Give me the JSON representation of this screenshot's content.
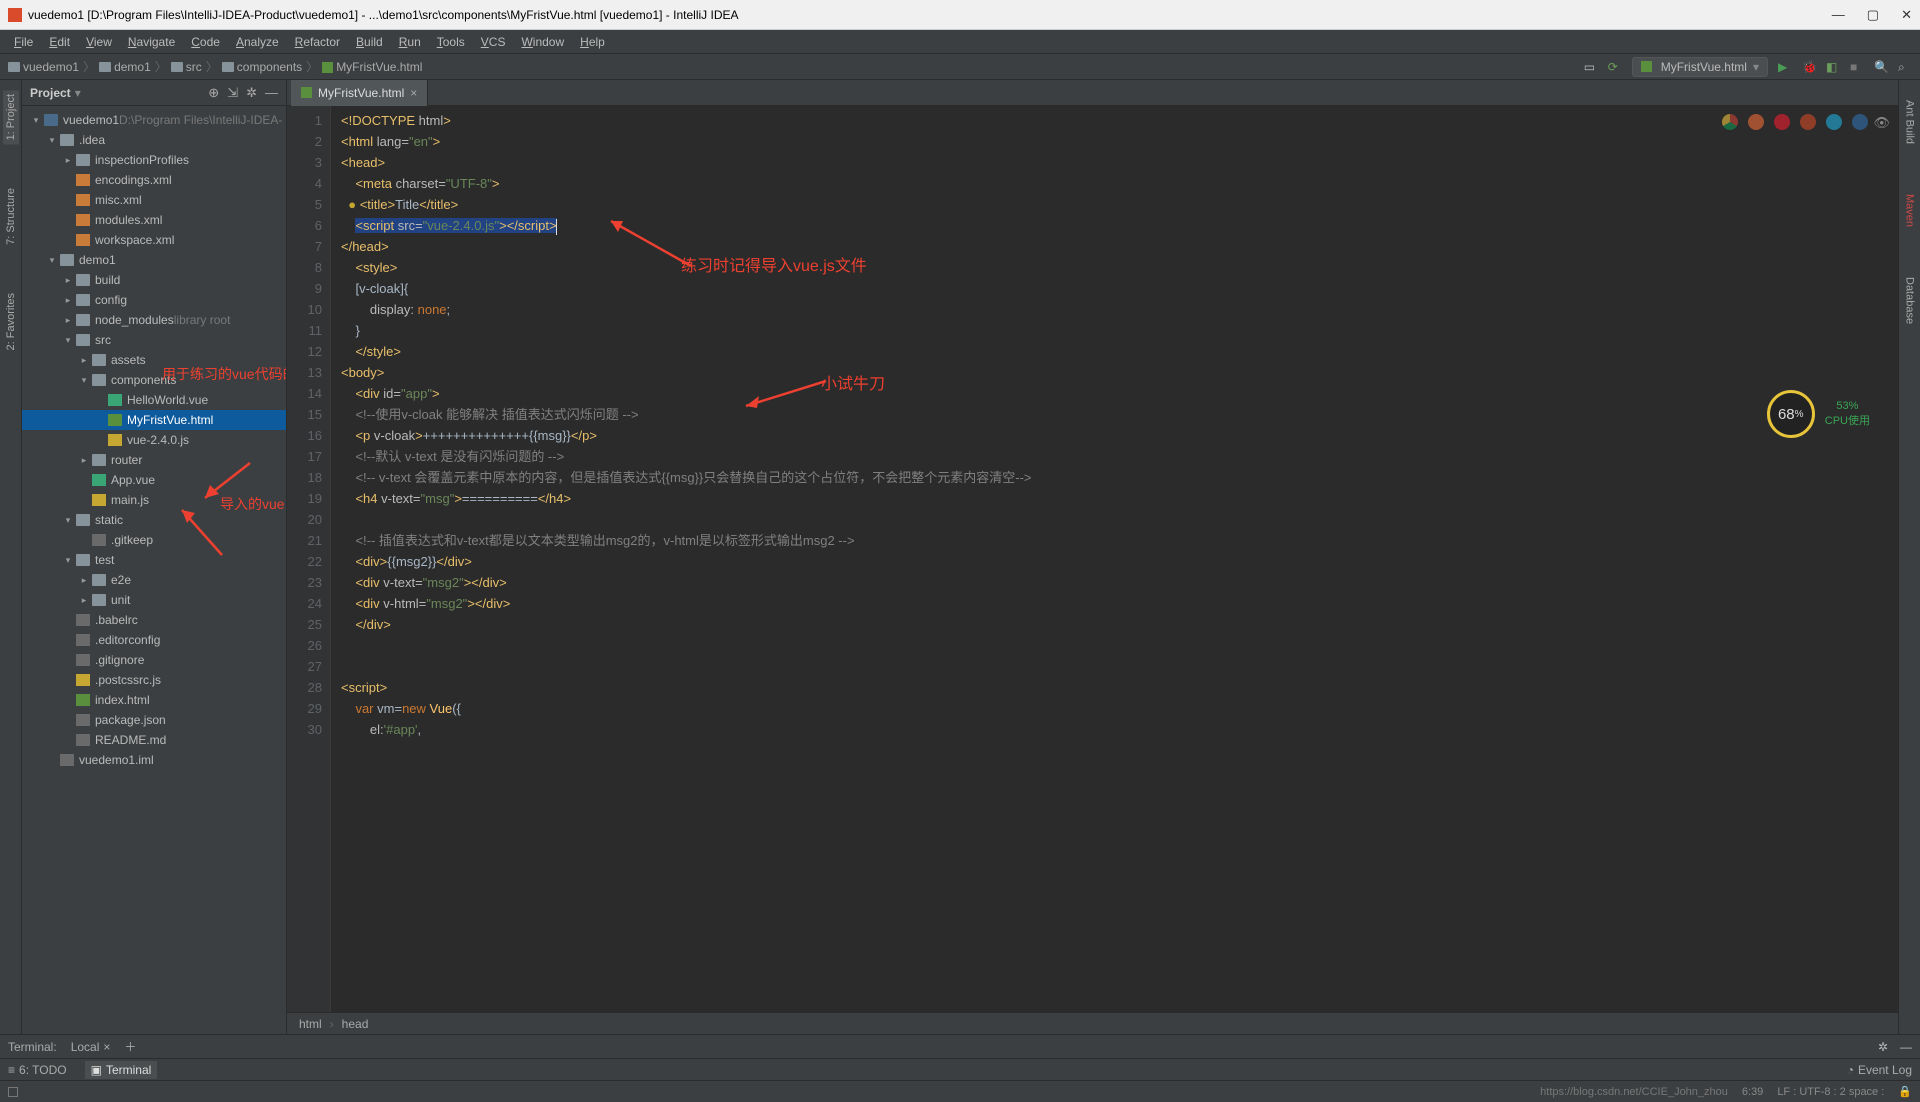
{
  "titlebar": {
    "text": "vuedemo1 [D:\\Program Files\\IntelliJ-IDEA-Product\\vuedemo1] - ...\\demo1\\src\\components\\MyFristVue.html [vuedemo1] - IntelliJ IDEA"
  },
  "menu": [
    "File",
    "Edit",
    "View",
    "Navigate",
    "Code",
    "Analyze",
    "Refactor",
    "Build",
    "Run",
    "Tools",
    "VCS",
    "Window",
    "Help"
  ],
  "breadcrumb": [
    "vuedemo1",
    "demo1",
    "src",
    "components",
    "MyFristVue.html"
  ],
  "run_config": "MyFristVue.html",
  "project": {
    "title": "Project",
    "root": {
      "name": "vuedemo1",
      "path": "D:\\Program Files\\IntelliJ-IDEA-..."
    }
  },
  "tree": [
    {
      "d": 0,
      "t": "chev",
      "open": true,
      "icon": "ic-folder-mod",
      "label": "vuedemo1",
      "suffix": "D:\\Program Files\\IntelliJ-IDEA-"
    },
    {
      "d": 1,
      "t": "chev",
      "open": true,
      "icon": "ic-folder",
      "label": ".idea"
    },
    {
      "d": 2,
      "t": "chev",
      "open": false,
      "icon": "ic-folder",
      "label": "inspectionProfiles"
    },
    {
      "d": 2,
      "t": "none",
      "icon": "ic-xml",
      "label": "encodings.xml"
    },
    {
      "d": 2,
      "t": "none",
      "icon": "ic-xml",
      "label": "misc.xml"
    },
    {
      "d": 2,
      "t": "none",
      "icon": "ic-xml",
      "label": "modules.xml"
    },
    {
      "d": 2,
      "t": "none",
      "icon": "ic-xml",
      "label": "workspace.xml"
    },
    {
      "d": 1,
      "t": "chev",
      "open": true,
      "icon": "ic-folder",
      "label": "demo1"
    },
    {
      "d": 2,
      "t": "chev",
      "open": false,
      "icon": "ic-folder",
      "label": "build"
    },
    {
      "d": 2,
      "t": "chev",
      "open": false,
      "icon": "ic-folder",
      "label": "config"
    },
    {
      "d": 2,
      "t": "chev",
      "open": false,
      "icon": "ic-folder",
      "label": "node_modules",
      "suffix": "library root"
    },
    {
      "d": 2,
      "t": "chev",
      "open": true,
      "icon": "ic-folder",
      "label": "src"
    },
    {
      "d": 3,
      "t": "chev",
      "open": false,
      "icon": "ic-folder",
      "label": "assets"
    },
    {
      "d": 3,
      "t": "chev",
      "open": true,
      "icon": "ic-folder",
      "label": "components"
    },
    {
      "d": 4,
      "t": "none",
      "icon": "ic-vue",
      "label": "HelloWorld.vue"
    },
    {
      "d": 4,
      "t": "none",
      "icon": "ic-html",
      "label": "MyFristVue.html",
      "selected": true
    },
    {
      "d": 4,
      "t": "none",
      "icon": "ic-js",
      "label": "vue-2.4.0.js"
    },
    {
      "d": 3,
      "t": "chev",
      "open": false,
      "icon": "ic-folder",
      "label": "router"
    },
    {
      "d": 3,
      "t": "none",
      "icon": "ic-vue",
      "label": "App.vue"
    },
    {
      "d": 3,
      "t": "none",
      "icon": "ic-js",
      "label": "main.js"
    },
    {
      "d": 2,
      "t": "chev",
      "open": true,
      "icon": "ic-folder",
      "label": "static"
    },
    {
      "d": 3,
      "t": "none",
      "icon": "ic-txt",
      "label": ".gitkeep"
    },
    {
      "d": 2,
      "t": "chev",
      "open": true,
      "icon": "ic-folder",
      "label": "test"
    },
    {
      "d": 3,
      "t": "chev",
      "open": false,
      "icon": "ic-folder",
      "label": "e2e"
    },
    {
      "d": 3,
      "t": "chev",
      "open": false,
      "icon": "ic-folder",
      "label": "unit"
    },
    {
      "d": 2,
      "t": "none",
      "icon": "ic-txt",
      "label": ".babelrc"
    },
    {
      "d": 2,
      "t": "none",
      "icon": "ic-txt",
      "label": ".editorconfig"
    },
    {
      "d": 2,
      "t": "none",
      "icon": "ic-txt",
      "label": ".gitignore"
    },
    {
      "d": 2,
      "t": "none",
      "icon": "ic-js",
      "label": ".postcssrc.js"
    },
    {
      "d": 2,
      "t": "none",
      "icon": "ic-html",
      "label": "index.html"
    },
    {
      "d": 2,
      "t": "none",
      "icon": "ic-txt",
      "label": "package.json"
    },
    {
      "d": 2,
      "t": "none",
      "icon": "ic-txt",
      "label": "README.md"
    },
    {
      "d": 1,
      "t": "none",
      "icon": "ic-txt",
      "label": "vuedemo1.iml"
    }
  ],
  "editor_tab": "MyFristVue.html",
  "code": [
    {
      "n": 1,
      "html": "<span class='c-tag'>&lt;!DOCTYPE</span> <span class='c-attr'>html</span><span class='c-tag'>&gt;</span>"
    },
    {
      "n": 2,
      "html": "<span class='c-tag'>&lt;html</span> <span class='c-attr'>lang=</span><span class='c-str'>\"en\"</span><span class='c-tag'>&gt;</span>"
    },
    {
      "n": 3,
      "html": "<span class='c-tag'>&lt;head&gt;</span>"
    },
    {
      "n": 4,
      "html": "    <span class='c-tag'>&lt;meta</span> <span class='c-attr'>charset=</span><span class='c-str'>\"UTF-8\"</span><span class='c-tag'>&gt;</span>"
    },
    {
      "n": 5,
      "html": "  <span style='color:#c6a732'>●</span> <span class='c-tag'>&lt;title&gt;</span><span class='c-txt'>Title</span><span class='c-tag'>&lt;/title&gt;</span>"
    },
    {
      "n": 6,
      "html": "    <span style='background:#214283'><span class='c-tag'>&lt;script</span> <span class='c-attr'>src=</span><span class='c-str'>\"vue-2.4.0.js\"</span><span class='c-tag'>&gt;</span></span><span style='background:#214283'><span class='c-tag'>&lt;/script&gt;</span></span><span class='cursor-caret'></span>"
    },
    {
      "n": 7,
      "html": "<span class='c-tag'>&lt;/head&gt;</span>"
    },
    {
      "n": 8,
      "html": "    <span class='c-tag'>&lt;style&gt;</span>"
    },
    {
      "n": 9,
      "html": "    <span class='c-txt'>[v-cloak]{</span>"
    },
    {
      "n": 10,
      "html": "        <span class='c-attr'>display</span><span class='c-txt'>: </span><span class='c-kw'>none</span><span class='c-txt'>;</span>"
    },
    {
      "n": 11,
      "html": "    <span class='c-txt'>}</span>"
    },
    {
      "n": 12,
      "html": "    <span class='c-tag'>&lt;/style&gt;</span>"
    },
    {
      "n": 13,
      "html": "<span class='c-tag'>&lt;body&gt;</span>"
    },
    {
      "n": 14,
      "html": "    <span class='c-tag'>&lt;div</span> <span class='c-attr'>id=</span><span class='c-str'>\"app\"</span><span class='c-tag'>&gt;</span>"
    },
    {
      "n": 15,
      "html": "    <span class='c-cmt'>&lt;!--使用v-cloak 能够解决 插值表达式闪烁问题 --&gt;</span>"
    },
    {
      "n": 16,
      "html": "    <span class='c-tag'>&lt;p</span> <span class='c-attr'>v-cloak</span><span class='c-tag'>&gt;</span><span class='c-txt'>++++++++++++++{{msg}}</span><span class='c-tag'>&lt;/p&gt;</span>"
    },
    {
      "n": 17,
      "html": "    <span class='c-cmt'>&lt;!--默认 v-text 是没有闪烁问题的 --&gt;</span>"
    },
    {
      "n": 18,
      "html": "    <span class='c-cmt'>&lt;!-- v-text 会覆盖元素中原本的内容，但是插值表达式{{msg}}只会替换自己的这个占位符，不会把整个元素内容清空--&gt;</span>"
    },
    {
      "n": 19,
      "html": "    <span class='c-tag'>&lt;h4</span> <span class='c-attr'>v-text=</span><span class='c-str'>\"msg\"</span><span class='c-tag'>&gt;</span><span class='c-txt'>==========</span><span class='c-tag'>&lt;/h4&gt;</span>"
    },
    {
      "n": 20,
      "html": ""
    },
    {
      "n": 21,
      "html": "    <span class='c-cmt'>&lt;!-- 插值表达式和v-text都是以文本类型输出msg2的，v-html是以标签形式输出msg2 --&gt;</span>"
    },
    {
      "n": 22,
      "html": "    <span class='c-tag'>&lt;div&gt;</span><span class='c-txt'>{{msg2}}</span><span class='c-tag'>&lt;/div&gt;</span>"
    },
    {
      "n": 23,
      "html": "    <span class='c-tag'>&lt;div</span> <span class='c-attr'>v-text=</span><span class='c-str'>\"msg2\"</span><span class='c-tag'>&gt;&lt;/div&gt;</span>"
    },
    {
      "n": 24,
      "html": "    <span class='c-tag'>&lt;div</span> <span class='c-attr'>v-html=</span><span class='c-str'>\"msg2\"</span><span class='c-tag'>&gt;&lt;/div&gt;</span>"
    },
    {
      "n": 25,
      "html": "    <span class='c-tag'>&lt;/div&gt;</span>"
    },
    {
      "n": 26,
      "html": ""
    },
    {
      "n": 27,
      "html": ""
    },
    {
      "n": 28,
      "html": "<span class='c-tag'>&lt;script&gt;</span>"
    },
    {
      "n": 29,
      "html": "    <span class='c-kw'>var</span> <span class='c-txt'>vm=</span><span class='c-kw'>new</span> <span class='c-fn'>Vue</span><span class='c-txt'>({</span>"
    },
    {
      "n": 30,
      "html": "        <span class='c-attr'>el</span><span class='c-txt'>:</span><span class='c-str'>'#app'</span><span class='c-txt'>,</span>"
    }
  ],
  "editor_breadcrumb": [
    "html",
    "head"
  ],
  "annotations": {
    "a1": "练习时记得导入vue.js文件",
    "a2": "小试牛刀",
    "a3": "用于练习的vue代码的html",
    "a4": "导入的vue.js"
  },
  "cpu": {
    "pct": "68",
    "unit": "%",
    "right_pct": "53%",
    "label": "CPU使用"
  },
  "tool_row": {
    "terminal": "Terminal:",
    "local": "Local"
  },
  "bottom_tools": {
    "todo": "6: TODO",
    "terminal": "Terminal",
    "event": "Event Log"
  },
  "status": {
    "pos": "6:39",
    "enc": "LF : UTF-8 : 2 space :",
    "wm": "https://blog.csdn.net/CCIE_John_zhou"
  },
  "left_tabs": [
    "1: Project",
    "7: Structure",
    "2: Favorites"
  ],
  "right_tabs": [
    "Ant Build",
    "Maven",
    "Database"
  ]
}
